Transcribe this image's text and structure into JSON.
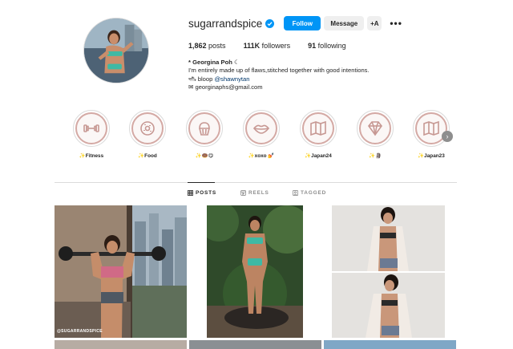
{
  "profile": {
    "username": "sugarrandspice",
    "follow_label": "Follow",
    "message_label": "Message",
    "add_user_label": "+A",
    "more_label": "•••",
    "stats": {
      "posts_count": "1,862",
      "posts_label": "posts",
      "followers_count": "111K",
      "followers_label": "followers",
      "following_count": "91",
      "following_label": "following"
    },
    "bio": {
      "name": "* Georgina Poh ☾",
      "line1": "I'm entirely made up of flaws,stitched together with good intentions.",
      "line2_prefix": "🛥 bloop ",
      "line2_link": "@shawnytan",
      "line3": "✉ georginaphs@gmail.com"
    }
  },
  "highlights": [
    {
      "label": "✨Fitness",
      "icon": "dumbbell-icon"
    },
    {
      "label": "✨Food",
      "icon": "donut-icon"
    },
    {
      "label": "✨🍩😋",
      "icon": "cupcake-icon"
    },
    {
      "label": "✨xoxo 💅",
      "icon": "lips-icon"
    },
    {
      "label": "✨Japan24",
      "icon": "map-icon"
    },
    {
      "label": "✨🗿",
      "icon": "diamond-icon"
    },
    {
      "label": "✨Japan23",
      "icon": "map-icon"
    }
  ],
  "tabs": [
    {
      "label": "POSTS",
      "icon": "grid-icon",
      "active": true
    },
    {
      "label": "REELS",
      "icon": "reels-icon",
      "active": false
    },
    {
      "label": "TAGGED",
      "icon": "tag-icon",
      "active": false
    }
  ],
  "posts": {
    "watermark": "@SUGARRANDSPICE"
  },
  "colors": {
    "accent": "#0095f6",
    "highlight_ring": "#d4a9a4",
    "link": "#00376b"
  }
}
